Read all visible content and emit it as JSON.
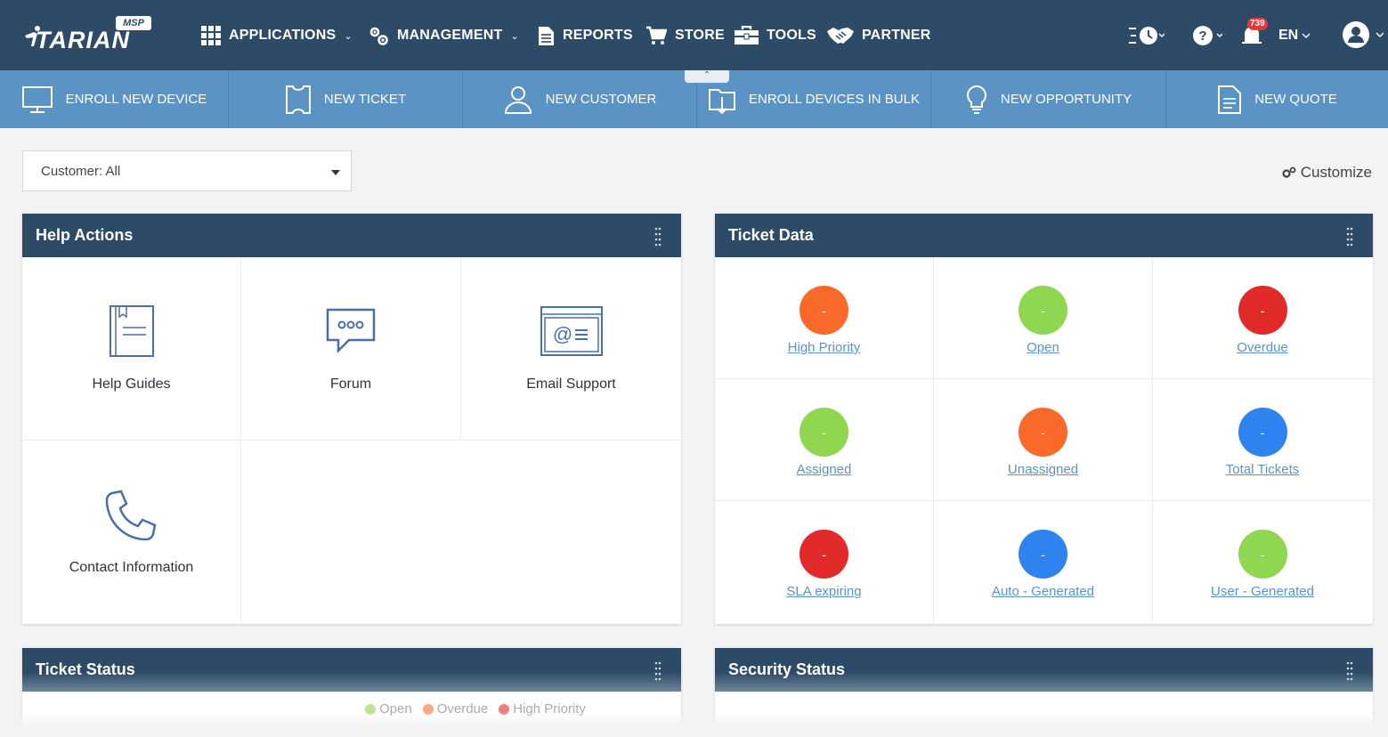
{
  "colors": {
    "nav_bg": "#2d4b66",
    "quick_bar_bg": "#5a93c4",
    "link": "#5a93c4",
    "orange": "#f96a2a",
    "green": "#8fd651",
    "red": "#e32a2a",
    "blue": "#2f83f0"
  },
  "logo": {
    "brand": "TARIAN",
    "badge": "MSP"
  },
  "nav": {
    "applications": "APPLICATIONS",
    "management": "MANAGEMENT",
    "reports": "REPORTS",
    "store": "STORE",
    "tools": "TOOLS",
    "partner": "PARTNER",
    "notifications_count": "739",
    "language": "EN"
  },
  "quick_actions": [
    {
      "label": "ENROLL NEW DEVICE",
      "icon": "monitor-icon"
    },
    {
      "label": "NEW TICKET",
      "icon": "ticket-icon"
    },
    {
      "label": "NEW CUSTOMER",
      "icon": "user-icon"
    },
    {
      "label": "ENROLL DEVICES IN BULK",
      "icon": "bulk-enroll-icon"
    },
    {
      "label": "NEW OPPORTUNITY",
      "icon": "lightbulb-icon"
    },
    {
      "label": "NEW QUOTE",
      "icon": "document-icon"
    }
  ],
  "filters": {
    "customer": "Customer: All"
  },
  "customize_label": "Customize",
  "help_actions": {
    "title": "Help Actions",
    "items": [
      {
        "label": "Help Guides",
        "icon": "book-icon"
      },
      {
        "label": "Forum",
        "icon": "forum-icon"
      },
      {
        "label": "Email Support",
        "icon": "email-icon"
      },
      {
        "label": "Contact Information",
        "icon": "phone-icon"
      }
    ]
  },
  "ticket_data": {
    "title": "Ticket Data",
    "items": [
      {
        "label": "High Priority",
        "value": "-",
        "color": "#f96a2a"
      },
      {
        "label": "Open",
        "value": "-",
        "color": "#8fd651"
      },
      {
        "label": "Overdue",
        "value": "-",
        "color": "#e32a2a"
      },
      {
        "label": "Assigned",
        "value": "-",
        "color": "#8fd651"
      },
      {
        "label": "Unassigned",
        "value": "-",
        "color": "#f96a2a"
      },
      {
        "label": "Total Tickets",
        "value": "-",
        "color": "#2f83f0"
      },
      {
        "label": "SLA expiring",
        "value": "-",
        "color": "#e32a2a"
      },
      {
        "label": "Auto - Generated",
        "value": "-",
        "color": "#2f83f0"
      },
      {
        "label": "User - Generated",
        "value": "-",
        "color": "#8fd651"
      }
    ]
  },
  "ticket_status": {
    "title": "Ticket Status",
    "legend": [
      {
        "label": "Open",
        "color": "#8fd651"
      },
      {
        "label": "Overdue",
        "color": "#f96a2a"
      },
      {
        "label": "High Priority",
        "color": "#e32a2a"
      }
    ]
  },
  "security_status": {
    "title": "Security Status"
  }
}
